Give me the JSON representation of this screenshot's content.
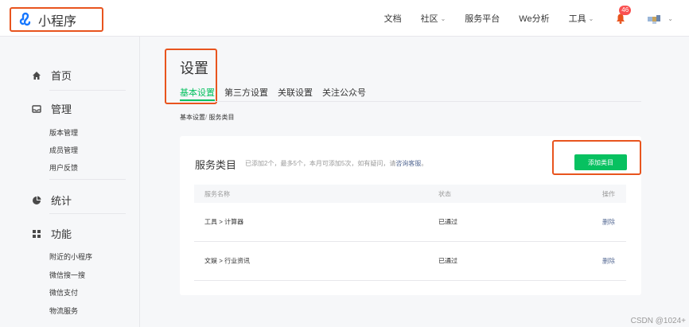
{
  "header": {
    "logo_text": "小程序",
    "nav": {
      "docs": "文档",
      "community": "社区",
      "service_platform": "服务平台",
      "we_analysis": "We分析",
      "tools": "工具"
    },
    "notification_count": "46"
  },
  "sidebar": {
    "sections": [
      {
        "icon": "home-icon",
        "label": "首页",
        "items": []
      },
      {
        "icon": "manage-icon",
        "label": "管理",
        "items": [
          "版本管理",
          "成员管理",
          "用户反馈"
        ]
      },
      {
        "icon": "stats-icon",
        "label": "统计",
        "items": []
      },
      {
        "icon": "feature-icon",
        "label": "功能",
        "items": [
          "附近的小程序",
          "微信搜一搜",
          "微信支付",
          "物流服务"
        ]
      }
    ]
  },
  "main": {
    "page_title": "设置",
    "tabs": [
      "基本设置",
      "第三方设置",
      "关联设置",
      "关注公众号"
    ],
    "active_tab": 0,
    "breadcrumb": {
      "root": "基本设置",
      "separator": "/",
      "current": "服务类目"
    },
    "card": {
      "title": "服务类目",
      "tip": "已添加2个，最多5个，本月可添加5次，如有疑问，请",
      "tip_link": "咨询客服",
      "tip_end": "。",
      "add_button": "添加类目",
      "columns": [
        "服务名称",
        "状态",
        "操作"
      ],
      "rows": [
        {
          "name": "工具 > 计算器",
          "status": "已通过",
          "action": "删除"
        },
        {
          "name": "文娱 > 行业资讯",
          "status": "已通过",
          "action": "删除"
        }
      ]
    }
  },
  "watermark": "CSDN @1024+",
  "colors": {
    "accent": "#07c160",
    "link": "#576b95",
    "highlight_border": "#e8541e"
  }
}
